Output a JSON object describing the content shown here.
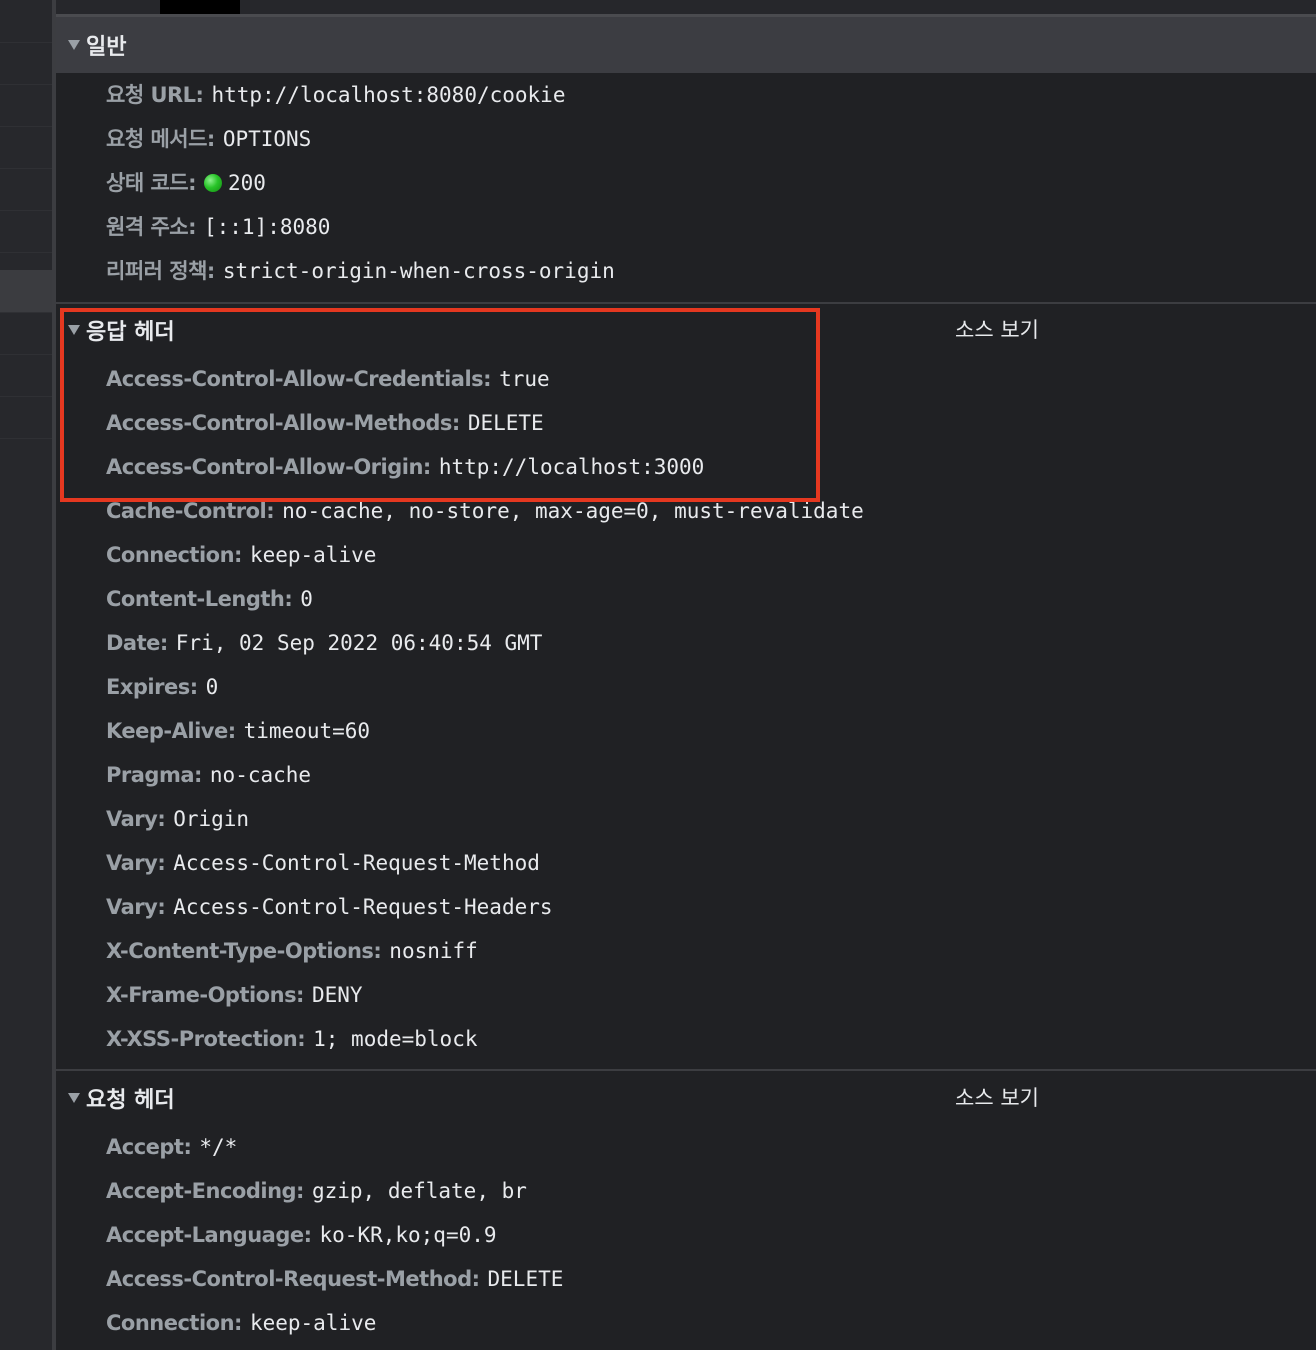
{
  "general": {
    "title": "일반",
    "rows": [
      {
        "key": "요청 URL:",
        "value": "http://localhost:8080/cookie"
      },
      {
        "key": "요청 메서드:",
        "value": "OPTIONS"
      },
      {
        "key": "상태 코드:",
        "value": "200",
        "status_color": "#28c428"
      },
      {
        "key": "원격 주소:",
        "value": "[::1]:8080"
      },
      {
        "key": "리퍼러 정책:",
        "value": "strict-origin-when-cross-origin"
      }
    ]
  },
  "response_headers": {
    "title": "응답 헤더",
    "view_source_label": "소스 보기",
    "rows": [
      {
        "key": "Access-Control-Allow-Credentials:",
        "value": "true"
      },
      {
        "key": "Access-Control-Allow-Methods:",
        "value": "DELETE"
      },
      {
        "key": "Access-Control-Allow-Origin:",
        "value": "http://localhost:3000"
      },
      {
        "key": "Cache-Control:",
        "value": "no-cache, no-store, max-age=0, must-revalidate"
      },
      {
        "key": "Connection:",
        "value": "keep-alive"
      },
      {
        "key": "Content-Length:",
        "value": "0"
      },
      {
        "key": "Date:",
        "value": "Fri, 02 Sep 2022 06:40:54 GMT"
      },
      {
        "key": "Expires:",
        "value": "0"
      },
      {
        "key": "Keep-Alive:",
        "value": "timeout=60"
      },
      {
        "key": "Pragma:",
        "value": "no-cache"
      },
      {
        "key": "Vary:",
        "value": "Origin"
      },
      {
        "key": "Vary:",
        "value": "Access-Control-Request-Method"
      },
      {
        "key": "Vary:",
        "value": "Access-Control-Request-Headers"
      },
      {
        "key": "X-Content-Type-Options:",
        "value": "nosniff"
      },
      {
        "key": "X-Frame-Options:",
        "value": "DENY"
      },
      {
        "key": "X-XSS-Protection:",
        "value": "1; mode=block"
      }
    ]
  },
  "request_headers": {
    "title": "요청 헤더",
    "view_source_label": "소스 보기",
    "rows": [
      {
        "key": "Accept:",
        "value": "*/*"
      },
      {
        "key": "Accept-Encoding:",
        "value": "gzip, deflate, br"
      },
      {
        "key": "Accept-Language:",
        "value": "ko-KR,ko;q=0.9"
      },
      {
        "key": "Access-Control-Request-Method:",
        "value": "DELETE"
      },
      {
        "key": "Connection:",
        "value": "keep-alive"
      }
    ]
  },
  "colors": {
    "background": "#202124",
    "header_key": "#9aa0a6",
    "header_value": "#e8eaed",
    "highlight": "#e53820"
  }
}
